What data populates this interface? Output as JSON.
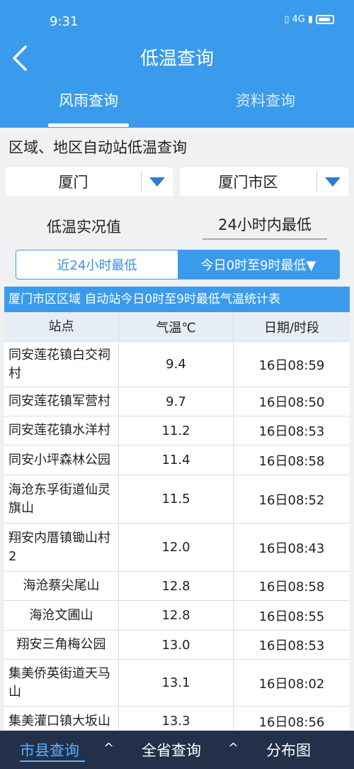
{
  "status": {
    "time": "9:31",
    "signal": "4G"
  },
  "header": {
    "title": "低温查询",
    "tabs": [
      "风雨查询",
      "资料查询"
    ]
  },
  "section_title": "区域、地区自动站低温查询",
  "selects": {
    "city": "厦门",
    "district": "厦门市区"
  },
  "modes": {
    "left": "低温实况值",
    "right": "24小时内最低"
  },
  "segment": {
    "option1": "近24小时最低",
    "option2": "今日0时至9时最低▼"
  },
  "table": {
    "title": "厦门市区区域 自动站今日0时至9时最低气温统计表",
    "headers": [
      "站点",
      "气温℃",
      "日期/时段"
    ],
    "rows": [
      {
        "station": "同安莲花镇白交祠村",
        "temp": "9.4",
        "time": "16日08:59"
      },
      {
        "station": "同安莲花镇军营村",
        "temp": "9.7",
        "time": "16日08:50"
      },
      {
        "station": "同安莲花镇水洋村",
        "temp": "11.2",
        "time": "16日08:53"
      },
      {
        "station": "同安小坪森林公园",
        "temp": "11.4",
        "time": "16日08:58"
      },
      {
        "station": "海沧东孚街道仙灵旗山",
        "temp": "11.5",
        "time": "16日08:52"
      },
      {
        "station": "翔安内厝镇锄山村2",
        "temp": "12.0",
        "time": "16日08:43"
      },
      {
        "station": "海沧蔡尖尾山",
        "temp": "12.8",
        "time": "16日08:58"
      },
      {
        "station": "海沧文圃山",
        "temp": "12.8",
        "time": "16日08:55"
      },
      {
        "station": "翔安三角梅公园",
        "temp": "13.0",
        "time": "16日08:53"
      },
      {
        "station": "集美侨英街道天马山",
        "temp": "13.1",
        "time": "16日08:02"
      },
      {
        "station": "集美灌口镇大坂山",
        "temp": "13.3",
        "time": "16日08:56"
      }
    ]
  },
  "bottom_nav": {
    "item1": "市县查询",
    "item2": "全省查询",
    "item3": "分布图",
    "caret": "^"
  }
}
